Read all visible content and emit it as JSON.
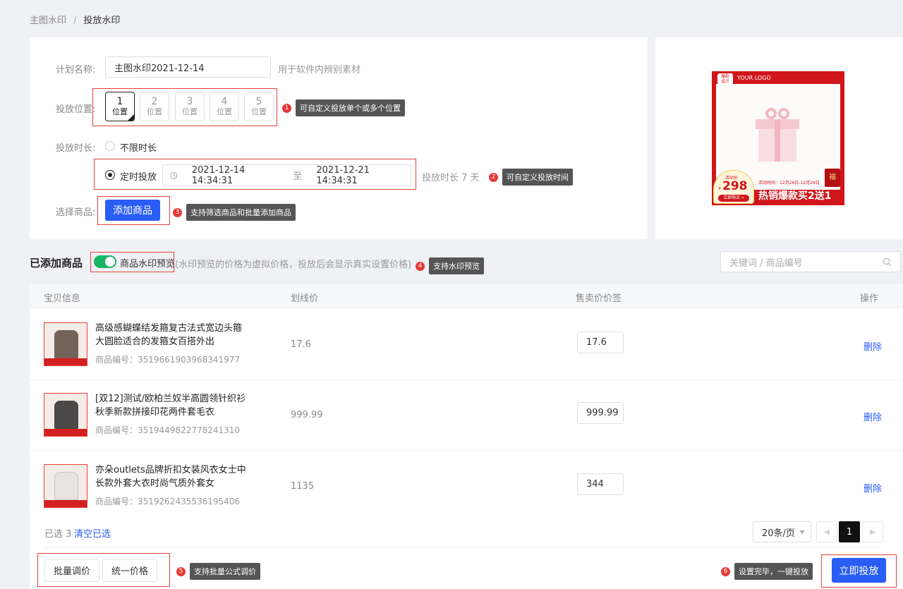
{
  "breadcrumb": {
    "parent": "主图水印",
    "separator": "/",
    "current": "投放水印"
  },
  "form": {
    "plan_name_label": "计划名称:",
    "plan_name_value": "主图水印2021-12-14",
    "plan_name_hint": "用于软件内辨别素材",
    "position_label": "投放位置:",
    "positions": [
      {
        "num": "1",
        "text": "位置",
        "active": true
      },
      {
        "num": "2",
        "text": "位置",
        "active": false
      },
      {
        "num": "3",
        "text": "位置",
        "active": false
      },
      {
        "num": "4",
        "text": "位置",
        "active": false
      },
      {
        "num": "5",
        "text": "位置",
        "active": false
      }
    ],
    "duration_label": "投放时长:",
    "unlimited_label": "不限时长",
    "scheduled_label": "定时投放",
    "start_time": "2021-12-14 14:34:31",
    "range_separator": "至",
    "end_time": "2021-12-21 14:34:31",
    "duration_hint": "投放时长 7 天",
    "select_label": "选择商品:",
    "add_button": "添加商品"
  },
  "tips": [
    {
      "num": "1",
      "text": "可自定义投放单个或多个位置"
    },
    {
      "num": "2",
      "text": "可自定义投放时间"
    },
    {
      "num": "3",
      "text": "支持筛选商品和批量添加商品"
    },
    {
      "num": "4",
      "text": "支持水印预览"
    },
    {
      "num": "5",
      "text": "支持批量公式调价"
    },
    {
      "num": "6",
      "text": "设置完毕，一键投放"
    }
  ],
  "preview": {
    "logo_badge": "爆款\n设计",
    "logo_text": "YOUR LOGO",
    "promo_price_label": "活动价",
    "promo_price": "298",
    "currency": "¥",
    "buy_now": "立即购买 »",
    "promo_time": "活动时间：12月26日-12月29日",
    "slogan": "热销爆款买2送1",
    "fu": "福"
  },
  "added": {
    "title": "已添加商品",
    "toggle_label": "商品水印预览",
    "toggle_note": "(水印预览的价格为虚拟价格，投放后会显示真实设置价格)",
    "search_placeholder": "关键词 / 商品编号"
  },
  "table": {
    "columns": [
      "宝贝信息",
      "划线价",
      "售卖价价签",
      "操作"
    ],
    "rows": [
      {
        "name": "高级感蝴蝶结发箍复古法式宽边头箍大圆脸适合的发箍女百搭外出",
        "code": "商品编号：3519661903968341977",
        "strike": "17.6",
        "price": "17.6",
        "action": "删除"
      },
      {
        "name": "[双12]测试/欧柏兰奴半高圆领针织衫秋季新款拼接印花两件套毛衣",
        "code": "商品编号：3519449822778241310",
        "strike": "999.99",
        "price": "999.99",
        "action": "删除"
      },
      {
        "name": "亦朵outlets品牌折扣女装风衣女士中长款外套大衣时尚气质外套女",
        "code": "商品编号：3519262435536195406",
        "strike": "1135",
        "price": "344",
        "action": "删除"
      }
    ]
  },
  "footer": {
    "selected": "已选 3",
    "clear": "清空已选",
    "page_size": "20条/页",
    "current_page": "1",
    "batch_adjust": "批量调价",
    "unify_price": "统一价格",
    "launch": "立即投放"
  },
  "colors": {
    "primary": "#2a5df5",
    "toggle": "#18b566",
    "annotation": "#e6423b"
  }
}
